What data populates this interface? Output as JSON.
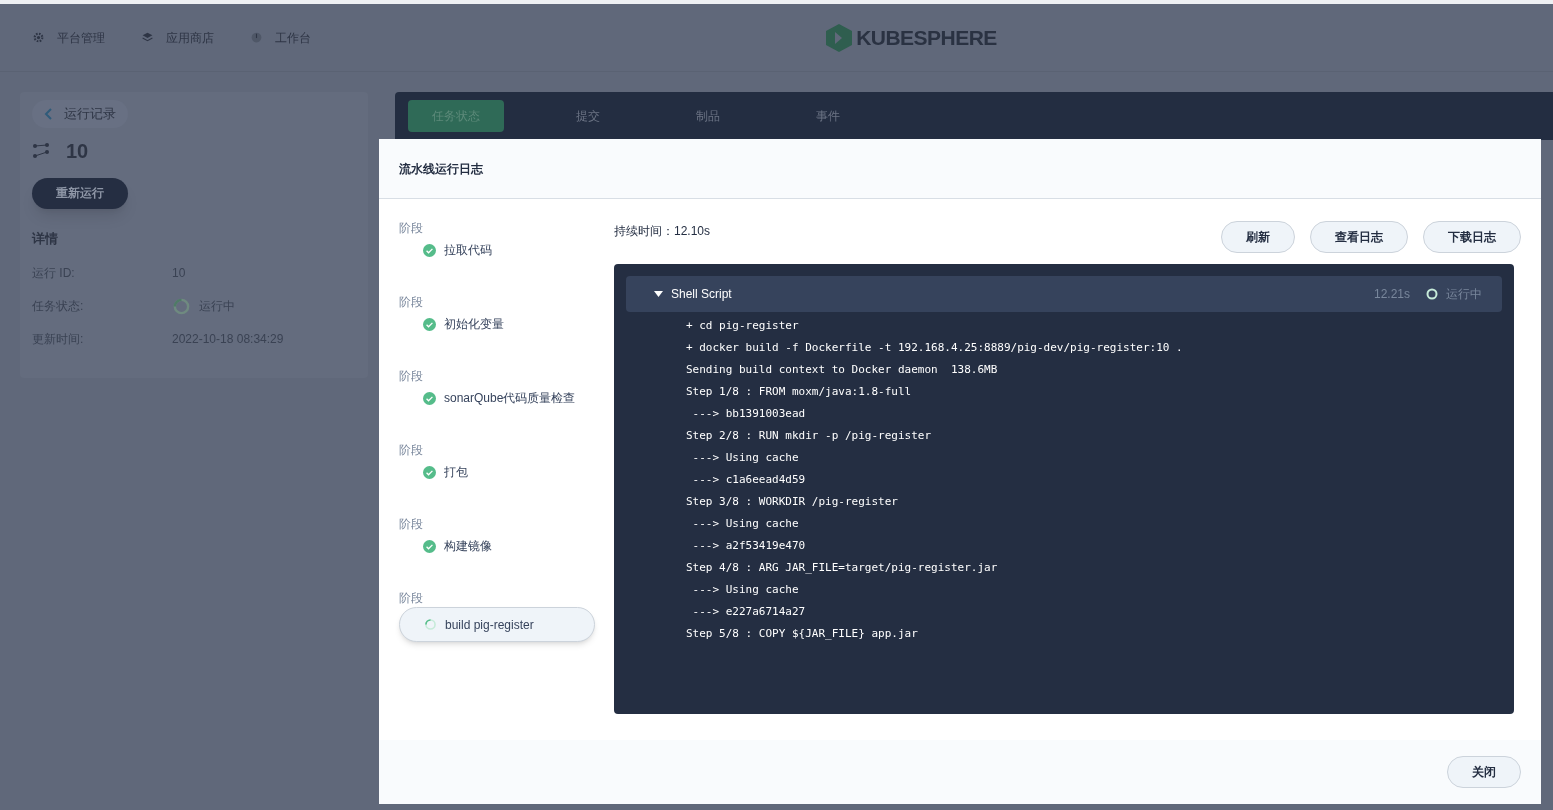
{
  "nav": [
    {
      "label": "平台管理",
      "kind": "gear"
    },
    {
      "label": "应用商店",
      "kind": "layers"
    },
    {
      "label": "工作台",
      "kind": "dial"
    }
  ],
  "logo": {
    "text": "KUBESPHERE"
  },
  "run": {
    "back_label": "运行记录",
    "number": "10",
    "rerun_button": "重新运行",
    "details_title": "详情",
    "fields": [
      {
        "label": "运行 ID:",
        "value": "10",
        "kind": "text"
      },
      {
        "label": "任务状态:",
        "value": "运行中",
        "kind": "status"
      },
      {
        "label": "更新时间:",
        "value": "2022-10-18 08:34:29",
        "kind": "text"
      }
    ]
  },
  "tabs": [
    {
      "label": "任务状态",
      "selected": true
    },
    {
      "label": "提交",
      "selected": false
    },
    {
      "label": "制品",
      "selected": false
    },
    {
      "label": "事件",
      "selected": false
    }
  ],
  "dialog": {
    "title": "流水线运行日志",
    "stages": [
      {
        "heading": "阶段",
        "name": "拉取代码",
        "kind": "success",
        "selected": false
      },
      {
        "heading": "阶段",
        "name": "初始化变量",
        "kind": "success",
        "selected": false
      },
      {
        "heading": "阶段",
        "name": "sonarQube代码质量检查",
        "kind": "success",
        "selected": false
      },
      {
        "heading": "阶段",
        "name": "打包",
        "kind": "success",
        "selected": false
      },
      {
        "heading": "阶段",
        "name": "构建镜像",
        "kind": "success",
        "selected": false
      },
      {
        "heading": "阶段",
        "name": "build pig-register",
        "kind": "running",
        "selected": true
      }
    ],
    "duration": "持续时间：12.10s",
    "buttons": [
      "刷新",
      "查看日志",
      "下载日志"
    ],
    "step": {
      "name": "Shell Script",
      "expanded": true,
      "time": "12.21s",
      "status": "运行中"
    },
    "log_lines": [
      "+ cd pig-register",
      "+ docker build -f Dockerfile -t 192.168.4.25:8889/pig-dev/pig-register:10 .",
      "Sending build context to Docker daemon  138.6MB",
      "Step 1/8 : FROM moxm/java:1.8-full",
      " ---> bb1391003ead",
      "Step 2/8 : RUN mkdir -p /pig-register",
      " ---> Using cache",
      " ---> c1a6eead4d59",
      "Step 3/8 : WORKDIR /pig-register",
      " ---> Using cache",
      " ---> a2f53419e470",
      "Step 4/8 : ARG JAR_FILE=target/pig-register.jar",
      " ---> Using cache",
      " ---> e227a6714a27",
      "Step 5/8 : COPY ${JAR_FILE} app.jar"
    ],
    "close_button": "关闭"
  }
}
